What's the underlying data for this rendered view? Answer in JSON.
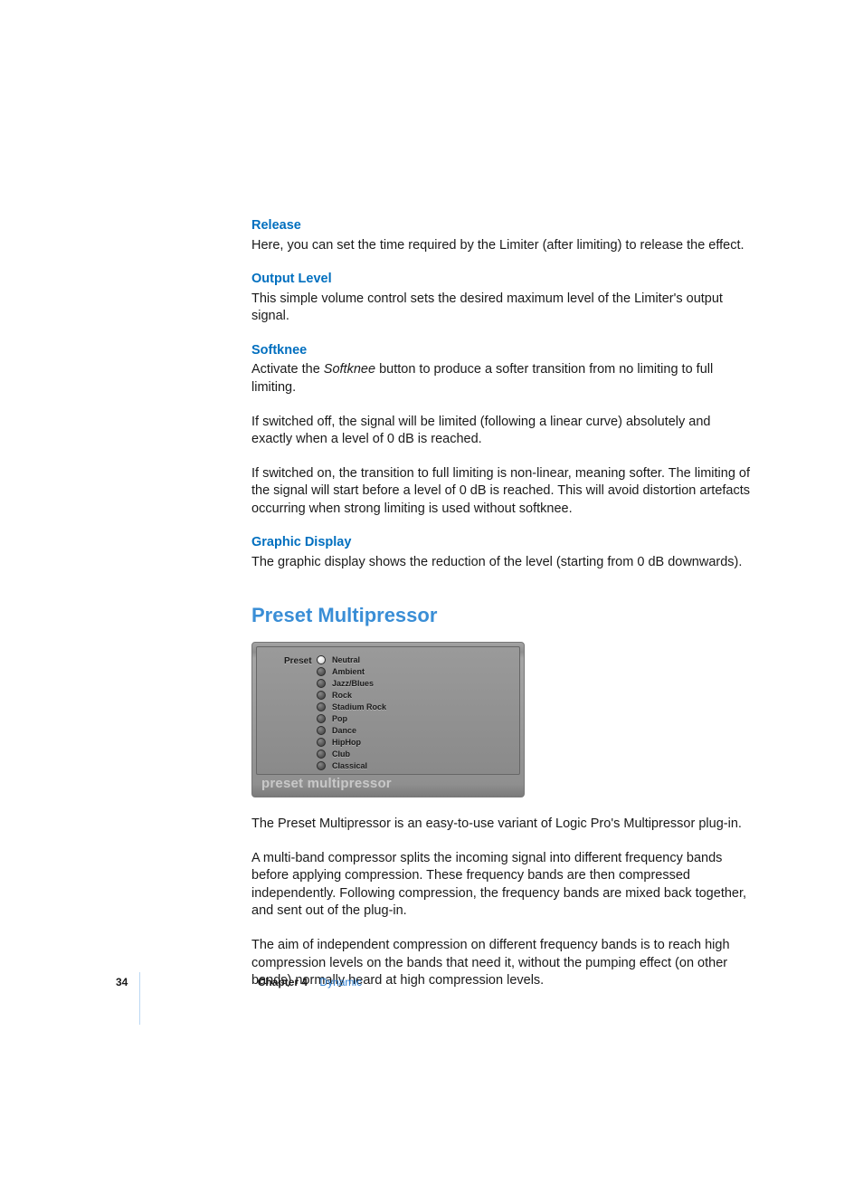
{
  "sections": {
    "release": {
      "h": "Release",
      "p": "Here, you can set the time required by the Limiter (after limiting) to release the effect."
    },
    "output": {
      "h": "Output Level",
      "p": "This simple volume control sets the desired maximum level of the Limiter's output signal."
    },
    "softknee": {
      "h": "Softknee",
      "p1a": "Activate the ",
      "p1i": "Softknee",
      "p1b": " button to produce a softer transition from no limiting to full limiting.",
      "p2": "If switched off, the signal will be limited (following a linear curve) absolutely and exactly when a level of 0 dB is reached.",
      "p3": "If switched on, the transition to full limiting is non-linear, meaning softer. The limiting of the signal will start before a level of 0 dB is reached. This will avoid distortion artefacts occurring when strong limiting is used without softknee."
    },
    "graphic": {
      "h": "Graphic Display",
      "p": "The graphic display shows the reduction of the level (starting from 0 dB downwards)."
    }
  },
  "main_heading": "Preset Multipressor",
  "preset": {
    "label": "Preset",
    "caption": "preset multipressor",
    "items": [
      "Neutral",
      "Ambient",
      "Jazz/Blues",
      "Rock",
      "Stadium Rock",
      "Pop",
      "Dance",
      "HipHop",
      "Club",
      "Classical"
    ],
    "selected_index": 0
  },
  "body": {
    "p1": "The Preset Multipressor is an easy-to-use variant of Logic Pro's Multipressor plug-in.",
    "p2": "A multi-band compressor splits the incoming signal into different frequency bands before applying compression. These frequency bands are then compressed independently. Following compression, the frequency bands are mixed back together, and sent out of the plug-in.",
    "p3": "The aim of independent compression on different frequency bands is to reach high compression levels on the bands that need it, without the pumping effect (on other bands) normally heard at high compression levels."
  },
  "footer": {
    "page": "34",
    "chapter": "Chapter 4",
    "title": "Dynamic"
  }
}
